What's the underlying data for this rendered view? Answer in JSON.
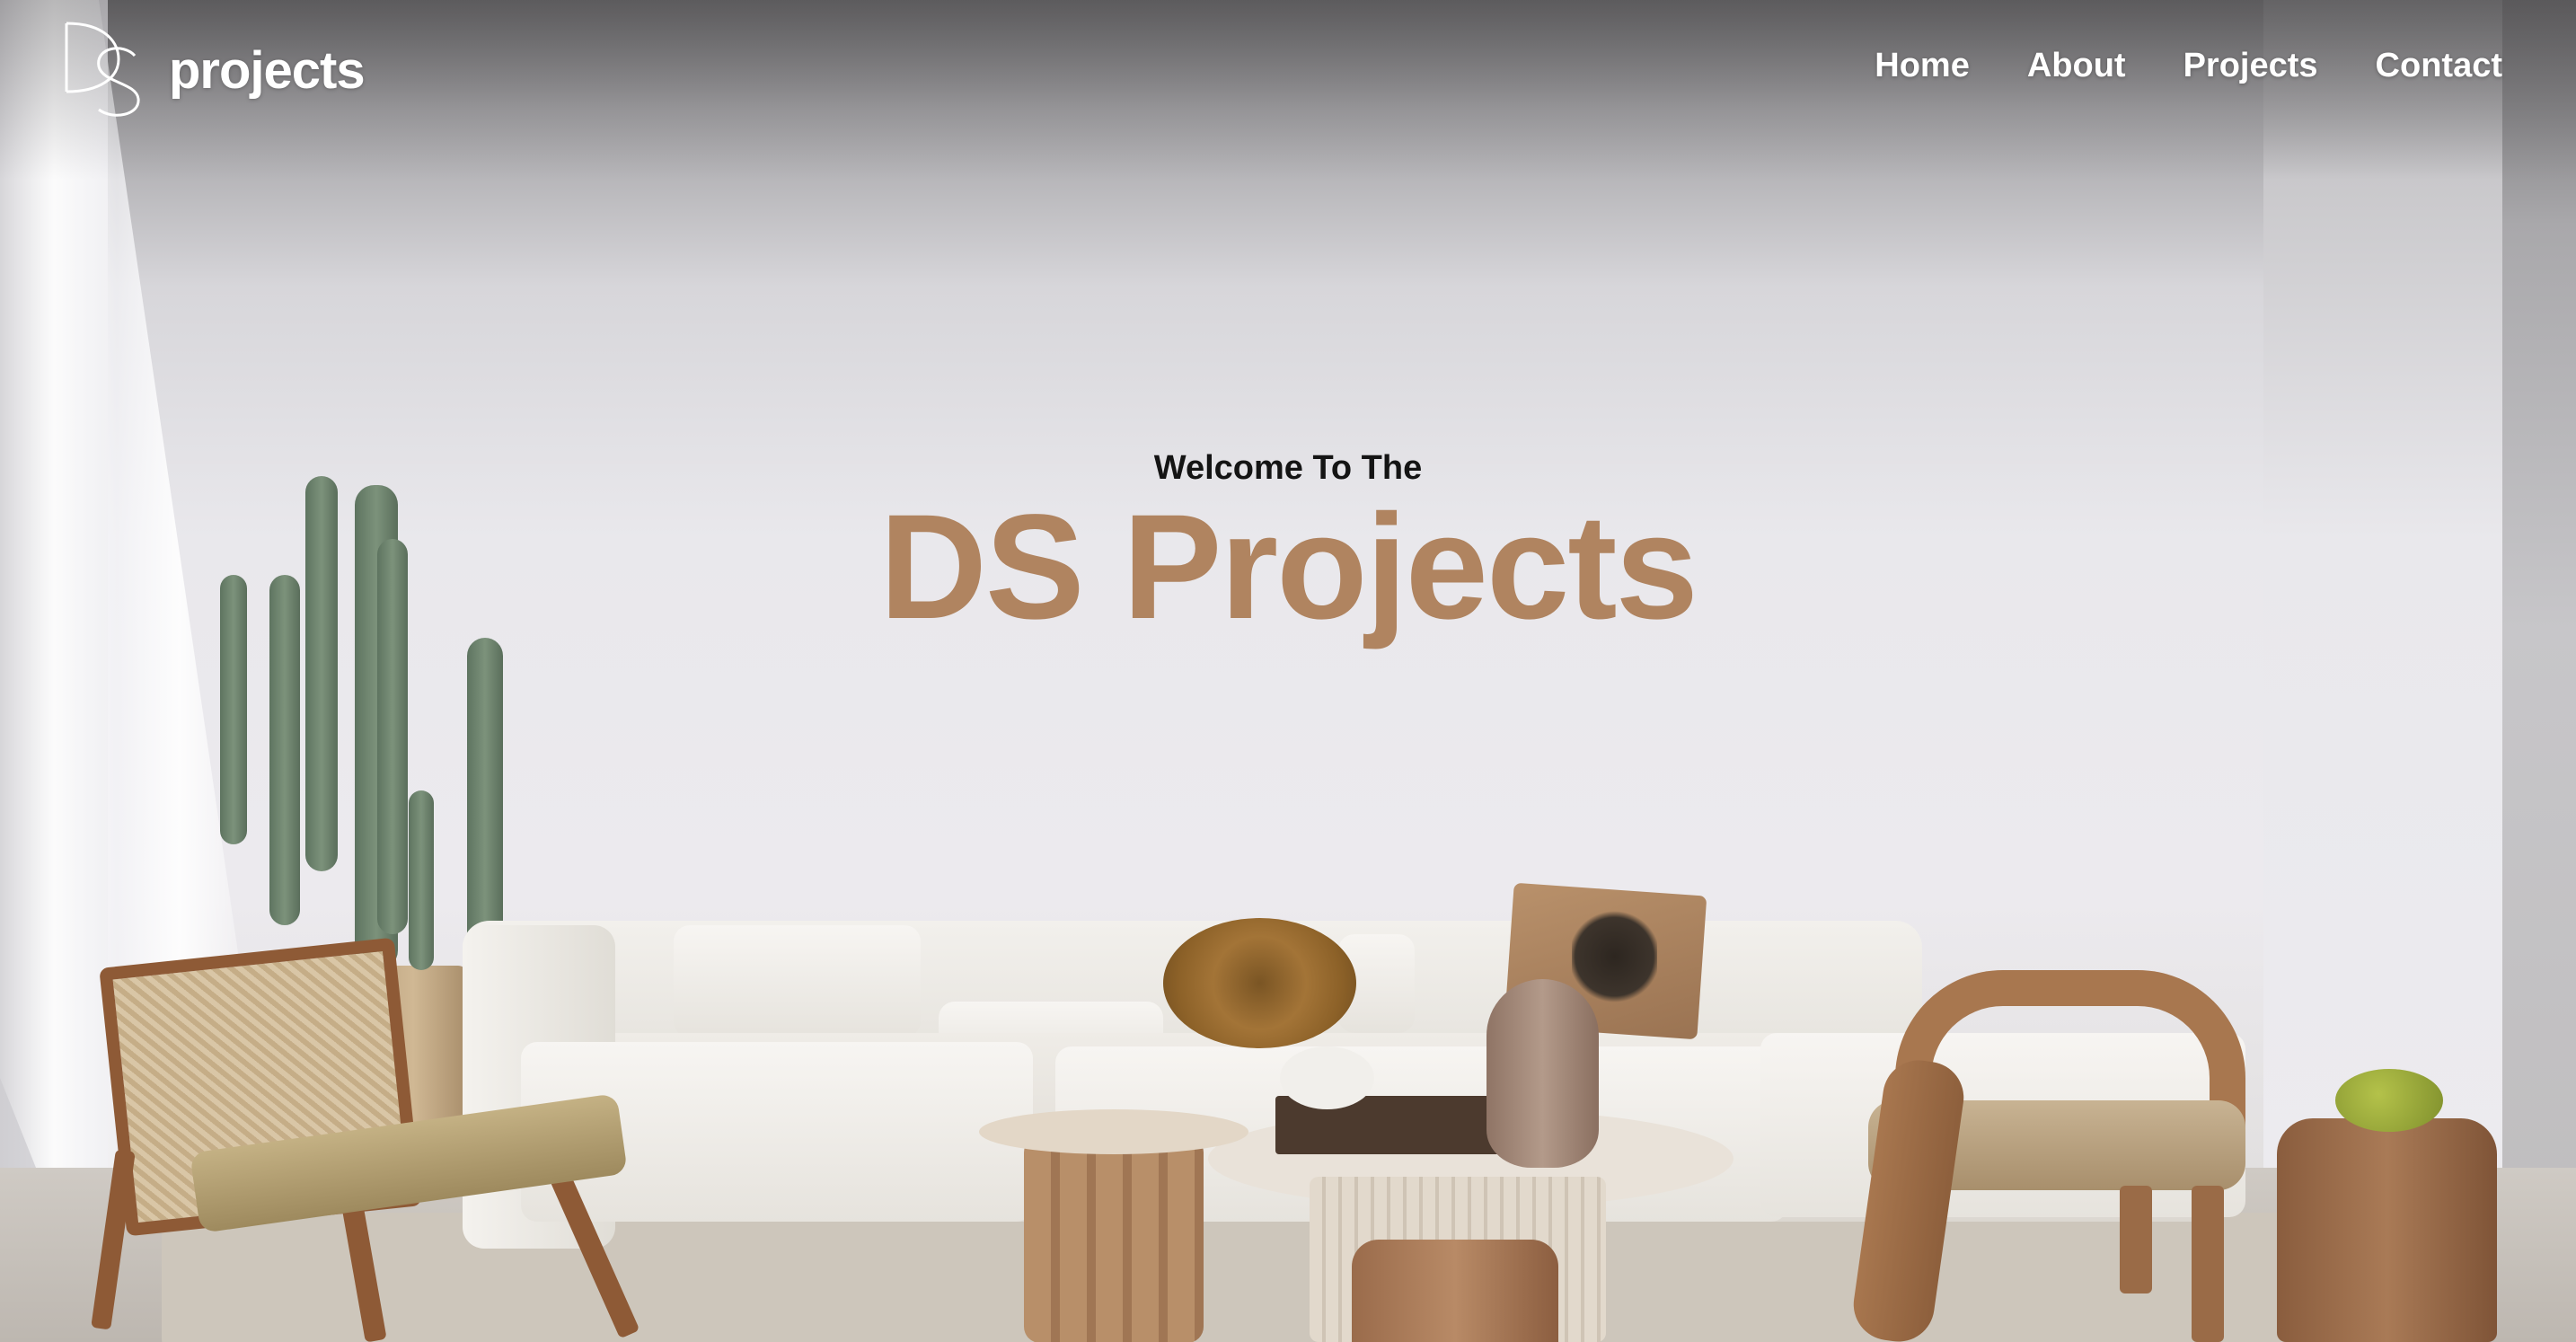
{
  "brand": {
    "mark": "DS",
    "name": "projects",
    "logo_icon": "ds-monogram-icon"
  },
  "nav": {
    "items": [
      {
        "label": "Home"
      },
      {
        "label": "About"
      },
      {
        "label": "Projects"
      },
      {
        "label": "Contact"
      }
    ]
  },
  "hero": {
    "kicker": "Welcome To The",
    "headline": "DS Projects",
    "background": "living-room-photo",
    "colors": {
      "headline": "#b08460",
      "kicker": "#141414",
      "nav_text": "#ffffff"
    }
  }
}
